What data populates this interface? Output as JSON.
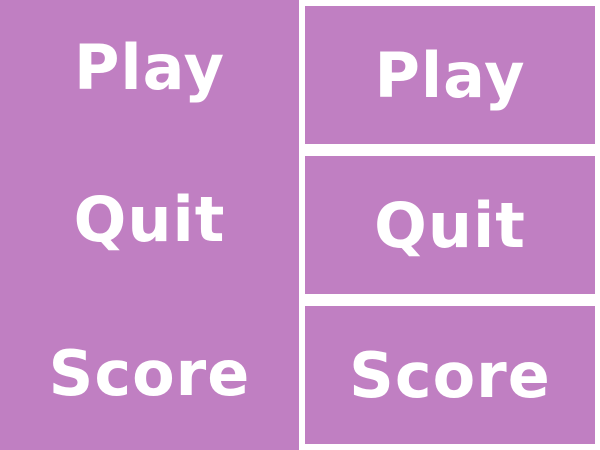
{
  "colors": {
    "panel": "#c07fc2",
    "text": "#ffffff",
    "background": "#ffffff"
  },
  "left_menu": {
    "items": [
      {
        "label": "Play"
      },
      {
        "label": "Quit"
      },
      {
        "label": "Score"
      }
    ]
  },
  "right_menu": {
    "items": [
      {
        "label": "Play"
      },
      {
        "label": "Quit"
      },
      {
        "label": "Score"
      }
    ]
  }
}
